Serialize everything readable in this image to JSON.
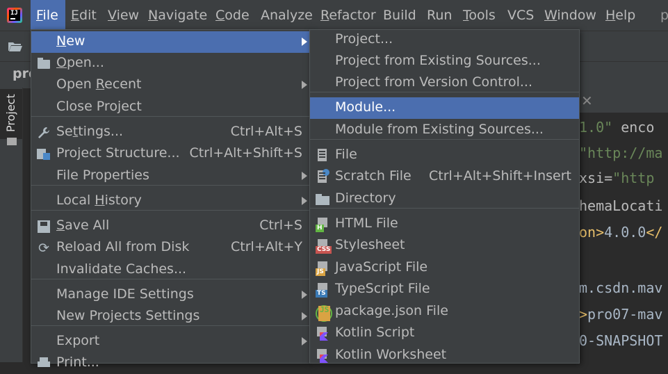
{
  "menubar": {
    "items": [
      {
        "label": "File",
        "u": "F",
        "rest": "ile"
      },
      {
        "label": "Edit",
        "u": "E",
        "rest": "dit"
      },
      {
        "label": "View",
        "u": "V",
        "rest": "iew"
      },
      {
        "label": "Navigate",
        "u": "N",
        "rest": "avigate"
      },
      {
        "label": "Code",
        "u": "C",
        "rest": "ode"
      },
      {
        "label": "Analyze",
        "u": "",
        "rest": "Analyze"
      },
      {
        "label": "Refactor",
        "u": "R",
        "rest": "efactor"
      },
      {
        "label": "Build",
        "u": "",
        "rest": "Build"
      },
      {
        "label": "Run",
        "u": "",
        "rest": "Run"
      },
      {
        "label": "Tools",
        "u": "T",
        "rest": "ools"
      },
      {
        "label": "VCS",
        "u": "",
        "rest": "VCS"
      },
      {
        "label": "Window",
        "u": "W",
        "rest": "indow"
      },
      {
        "label": "Help",
        "u": "H",
        "rest": "elp"
      }
    ],
    "tail": "p"
  },
  "breadcrumb": "pro",
  "tool_window": {
    "project_tab": "Project"
  },
  "file_menu": {
    "items": [
      {
        "pre": "",
        "u": "N",
        "post": "ew",
        "shortcut": "",
        "submenu": true,
        "selected": true,
        "icon": ""
      },
      {
        "pre": "",
        "u": "O",
        "post": "pen...",
        "shortcut": "",
        "submenu": false,
        "icon": "open-folder-icon"
      },
      {
        "pre": "Open ",
        "u": "R",
        "post": "ecent",
        "shortcut": "",
        "submenu": true,
        "icon": ""
      },
      {
        "pre": "Close Project",
        "u": "",
        "post": "",
        "shortcut": "",
        "submenu": false,
        "icon": ""
      },
      {
        "pre": "Se",
        "u": "t",
        "post": "tings...",
        "shortcut": "Ctrl+Alt+S",
        "submenu": false,
        "icon": "wrench-icon"
      },
      {
        "pre": "Project Structure...",
        "u": "",
        "post": "",
        "shortcut": "Ctrl+Alt+Shift+S",
        "submenu": false,
        "icon": "project-structure-icon"
      },
      {
        "pre": "File Properties",
        "u": "",
        "post": "",
        "shortcut": "",
        "submenu": true,
        "icon": ""
      },
      {
        "pre": "Local ",
        "u": "H",
        "post": "istory",
        "shortcut": "",
        "submenu": true,
        "icon": ""
      },
      {
        "pre": "",
        "u": "S",
        "post": "ave All",
        "shortcut": "Ctrl+S",
        "submenu": false,
        "icon": "save-icon"
      },
      {
        "pre": "Reload All from Disk",
        "u": "",
        "post": "",
        "shortcut": "Ctrl+Alt+Y",
        "submenu": false,
        "icon": "reload-icon"
      },
      {
        "pre": "Invalidate Caches...",
        "u": "",
        "post": "",
        "shortcut": "",
        "submenu": false,
        "icon": ""
      },
      {
        "pre": "Manage IDE Settings",
        "u": "",
        "post": "",
        "shortcut": "",
        "submenu": true,
        "icon": ""
      },
      {
        "pre": "New Projects Settings",
        "u": "",
        "post": "",
        "shortcut": "",
        "submenu": true,
        "icon": ""
      },
      {
        "pre": "Export",
        "u": "",
        "post": "",
        "shortcut": "",
        "submenu": true,
        "icon": ""
      },
      {
        "pre": "Print...",
        "u": "",
        "post": "",
        "shortcut": "",
        "submenu": false,
        "icon": "print-icon"
      }
    ]
  },
  "new_menu": {
    "items": [
      {
        "label": "Project...",
        "shortcut": "",
        "icon": ""
      },
      {
        "label": "Project from Existing Sources...",
        "shortcut": "",
        "icon": ""
      },
      {
        "label": "Project from Version Control...",
        "shortcut": "",
        "icon": ""
      },
      {
        "label": "Module...",
        "shortcut": "",
        "icon": "",
        "selected": true
      },
      {
        "label": "Module from Existing Sources...",
        "shortcut": "",
        "icon": ""
      },
      {
        "label": "File",
        "shortcut": "",
        "icon": "file-icon"
      },
      {
        "label": "Scratch File",
        "shortcut": "Ctrl+Alt+Shift+Insert",
        "icon": "scratch-file-icon"
      },
      {
        "label": "Directory",
        "shortcut": "",
        "icon": "directory-icon"
      },
      {
        "label": "HTML File",
        "shortcut": "",
        "icon": "html-file-icon",
        "badge": "H"
      },
      {
        "label": "Stylesheet",
        "shortcut": "",
        "icon": "css-file-icon",
        "badge": "CSS"
      },
      {
        "label": "JavaScript File",
        "shortcut": "",
        "icon": "js-file-icon",
        "badge": "JS"
      },
      {
        "label": "TypeScript File",
        "shortcut": "",
        "icon": "ts-file-icon",
        "badge": "TS"
      },
      {
        "label": "package.json File",
        "shortcut": "",
        "icon": "package-json-icon",
        "badge": "JS"
      },
      {
        "label": "Kotlin Script",
        "shortcut": "",
        "icon": "kotlin-script-icon"
      },
      {
        "label": "Kotlin Worksheet",
        "shortcut": "",
        "icon": "kotlin-worksheet-icon"
      }
    ]
  },
  "editor": {
    "lines": [
      {
        "parts": [
          {
            "t": "1.0\"",
            "c": "c-str"
          },
          {
            "t": " enco",
            "c": "c-attr"
          }
        ]
      },
      {
        "parts": [
          {
            "t": "\"http://ma",
            "c": "c-str"
          }
        ]
      },
      {
        "parts": [
          {
            "t": "xsi=",
            "c": "c-attr"
          },
          {
            "t": "\"http",
            "c": "c-str"
          }
        ]
      },
      {
        "parts": [
          {
            "t": "hemaLocati",
            "c": "c-attr"
          }
        ]
      },
      {
        "parts": [
          {
            "t": "on>",
            "c": "c-tag"
          },
          {
            "t": "4.0.0",
            "c": ""
          },
          {
            "t": "</",
            "c": "c-tag"
          }
        ]
      },
      {
        "parts": [
          {
            "t": "",
            "c": ""
          }
        ]
      },
      {
        "parts": [
          {
            "t": "m.csdn.mav",
            "c": ""
          }
        ]
      },
      {
        "parts": [
          {
            "t": ">",
            "c": "c-tag"
          },
          {
            "t": "pro07-mav",
            "c": ""
          }
        ]
      },
      {
        "parts": [
          {
            "t": "0-SNAPSHOT",
            "c": ""
          }
        ]
      }
    ]
  }
}
